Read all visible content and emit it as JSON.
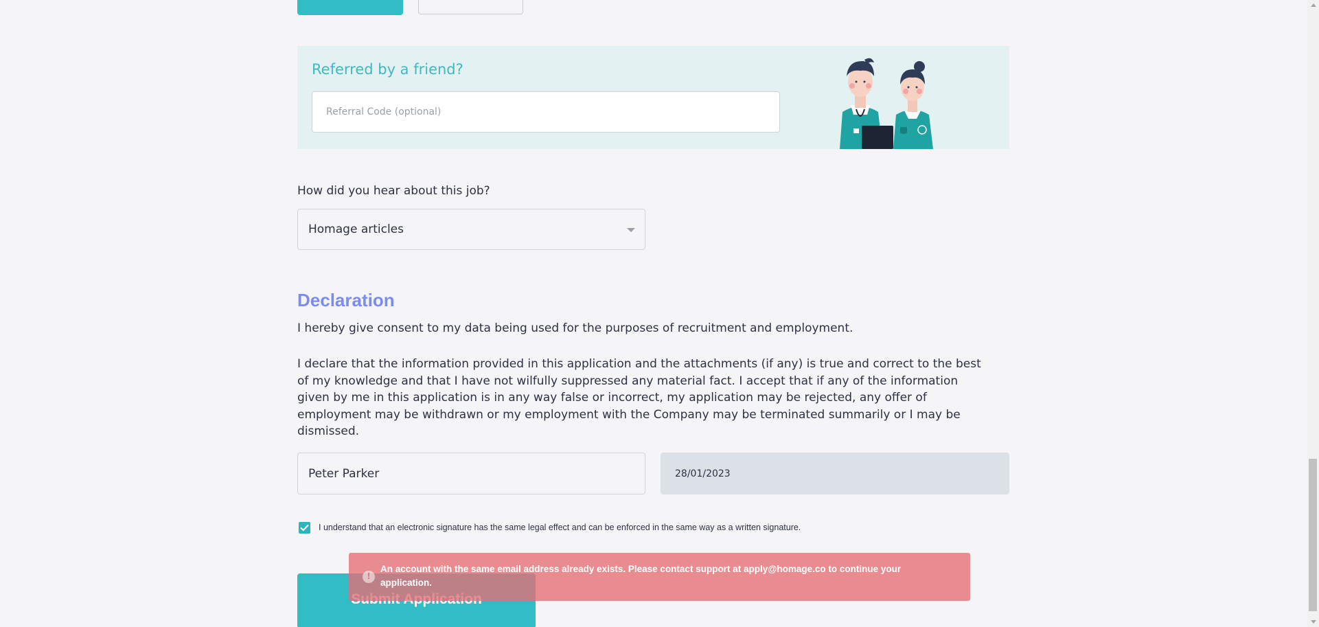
{
  "referral": {
    "title": "Referred by a friend?",
    "code_placeholder": "Referral Code (optional)",
    "illustration_icon": "healthcare-workers-illustration"
  },
  "hear_about": {
    "label": "How did you hear about this job?",
    "selected": "Homage articles"
  },
  "declaration": {
    "heading": "Declaration",
    "consent_text": "I hereby give consent to my data being used for the purposes of recruitment and employment.",
    "declare_text": "I declare that the information provided in this application and the attachments (if any) is true and correct to the best of my knowledge and that I have not wilfully suppressed any material fact. I accept that if any of the information given by me in this application is in any way false or incorrect, my application may be rejected, any offer of employment may be withdrawn or my employment with the Company may be terminated summarily or I may be dismissed.",
    "signature_name": "Peter Parker",
    "signature_date": "28/01/2023",
    "esign_label": "I understand that an electronic signature has the same legal effect and can be enforced in the same way as a written signature.",
    "esign_checked": true
  },
  "submit": {
    "label": "Submit Application"
  },
  "toast": {
    "message": "An account with the same email address already exists. Please contact support at apply@homage.co to continue your application.",
    "icon": "alert-icon"
  },
  "colors": {
    "accent": "#31bdc6",
    "heading": "#7b8cf0",
    "error": "#e66e73",
    "referral_bg": "#e3f1f3"
  }
}
